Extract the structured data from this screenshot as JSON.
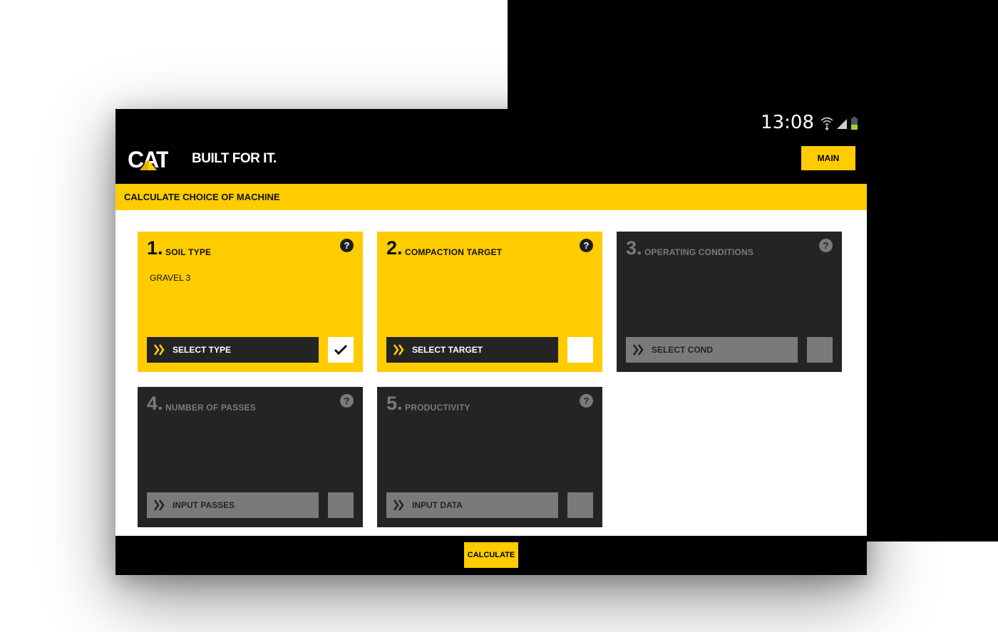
{
  "status_bar": {
    "time": "13:08",
    "icons": [
      "wifi-icon",
      "signal-icon",
      "battery-icon"
    ]
  },
  "header": {
    "brand": "CAT",
    "tagline": "BUILT FOR IT.",
    "main_button": "MAIN"
  },
  "page": {
    "title": "CALCULATE CHOICE OF MACHINE"
  },
  "steps": [
    {
      "num": "1.",
      "title": "SOIL TYPE",
      "value": "GRAVEL 3",
      "action": "SELECT TYPE",
      "state": "active",
      "checked": true
    },
    {
      "num": "2.",
      "title": "COMPACTION TARGET",
      "value": "",
      "action": "SELECT TARGET",
      "state": "active",
      "checked": false
    },
    {
      "num": "3.",
      "title": "OPERATING CONDITIONS",
      "value": "",
      "action": "SELECT COND",
      "state": "disabled",
      "checked": false
    },
    {
      "num": "4.",
      "title": "NUMBER OF PASSES",
      "value": "",
      "action": "INPUT PASSES",
      "state": "disabled",
      "checked": false
    },
    {
      "num": "5.",
      "title": "PRODUCTIVITY",
      "value": "",
      "action": "INPUT DATA",
      "state": "disabled",
      "checked": false
    }
  ],
  "help_symbol": "?",
  "footer": {
    "calculate_button": "CALCULATE"
  },
  "colors": {
    "accent": "#ffcc00",
    "dark": "#242424",
    "disabled": "#7a7a7a"
  }
}
